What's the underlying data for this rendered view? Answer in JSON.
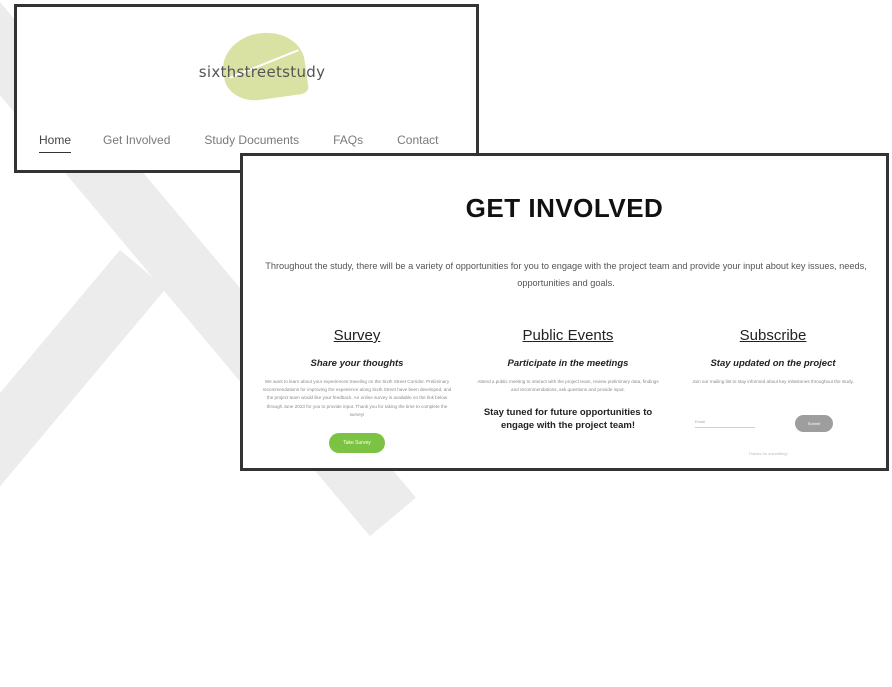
{
  "nav_window": {
    "logo_text": "sixthstreetstudy",
    "links": [
      {
        "label": "Home",
        "active": true
      },
      {
        "label": "Get Involved",
        "active": false
      },
      {
        "label": "Study Documents",
        "active": false
      },
      {
        "label": "FAQs",
        "active": false
      },
      {
        "label": "Contact",
        "active": false
      }
    ]
  },
  "page": {
    "title": "GET INVOLVED",
    "intro": "Throughout the study, there will be a variety of opportunities for you to engage with the project team and provide your input about key issues, needs, opportunities and goals."
  },
  "columns": {
    "survey": {
      "title": "Survey",
      "subtitle": "Share your thoughts",
      "body": "We want to learn about your experiences traveling on the Sixth Street Corridor. Preliminary recommendations for improving the experience along Sixth Street have been developed, and the project team would like your feedback. An online survey is available on the link below through June 2023 for you to provide input. Thank you for taking the time to complete the survey!",
      "button_label": "Take Survey"
    },
    "events": {
      "title": "Public Events",
      "subtitle": "Participate in the meetings",
      "body": "Attend a public meeting to interact with the project team, review preliminary data, findings and recommendations, ask questions and provide input.",
      "stay_tuned": "Stay tuned for future opportunities to engage with the project team!"
    },
    "subscribe": {
      "title": "Subscribe",
      "subtitle": "Stay updated on the project",
      "body": "Join our mailing list to stay informed about key milestones throughout the study.",
      "email_placeholder": "Email",
      "button_label": "Submit",
      "note": "Thanks for submitting!"
    }
  },
  "colors": {
    "logo_leaf": "#d9e2a3",
    "survey_button": "#7dc343",
    "subscribe_button": "#9e9e9e",
    "frame_border": "#333333"
  }
}
